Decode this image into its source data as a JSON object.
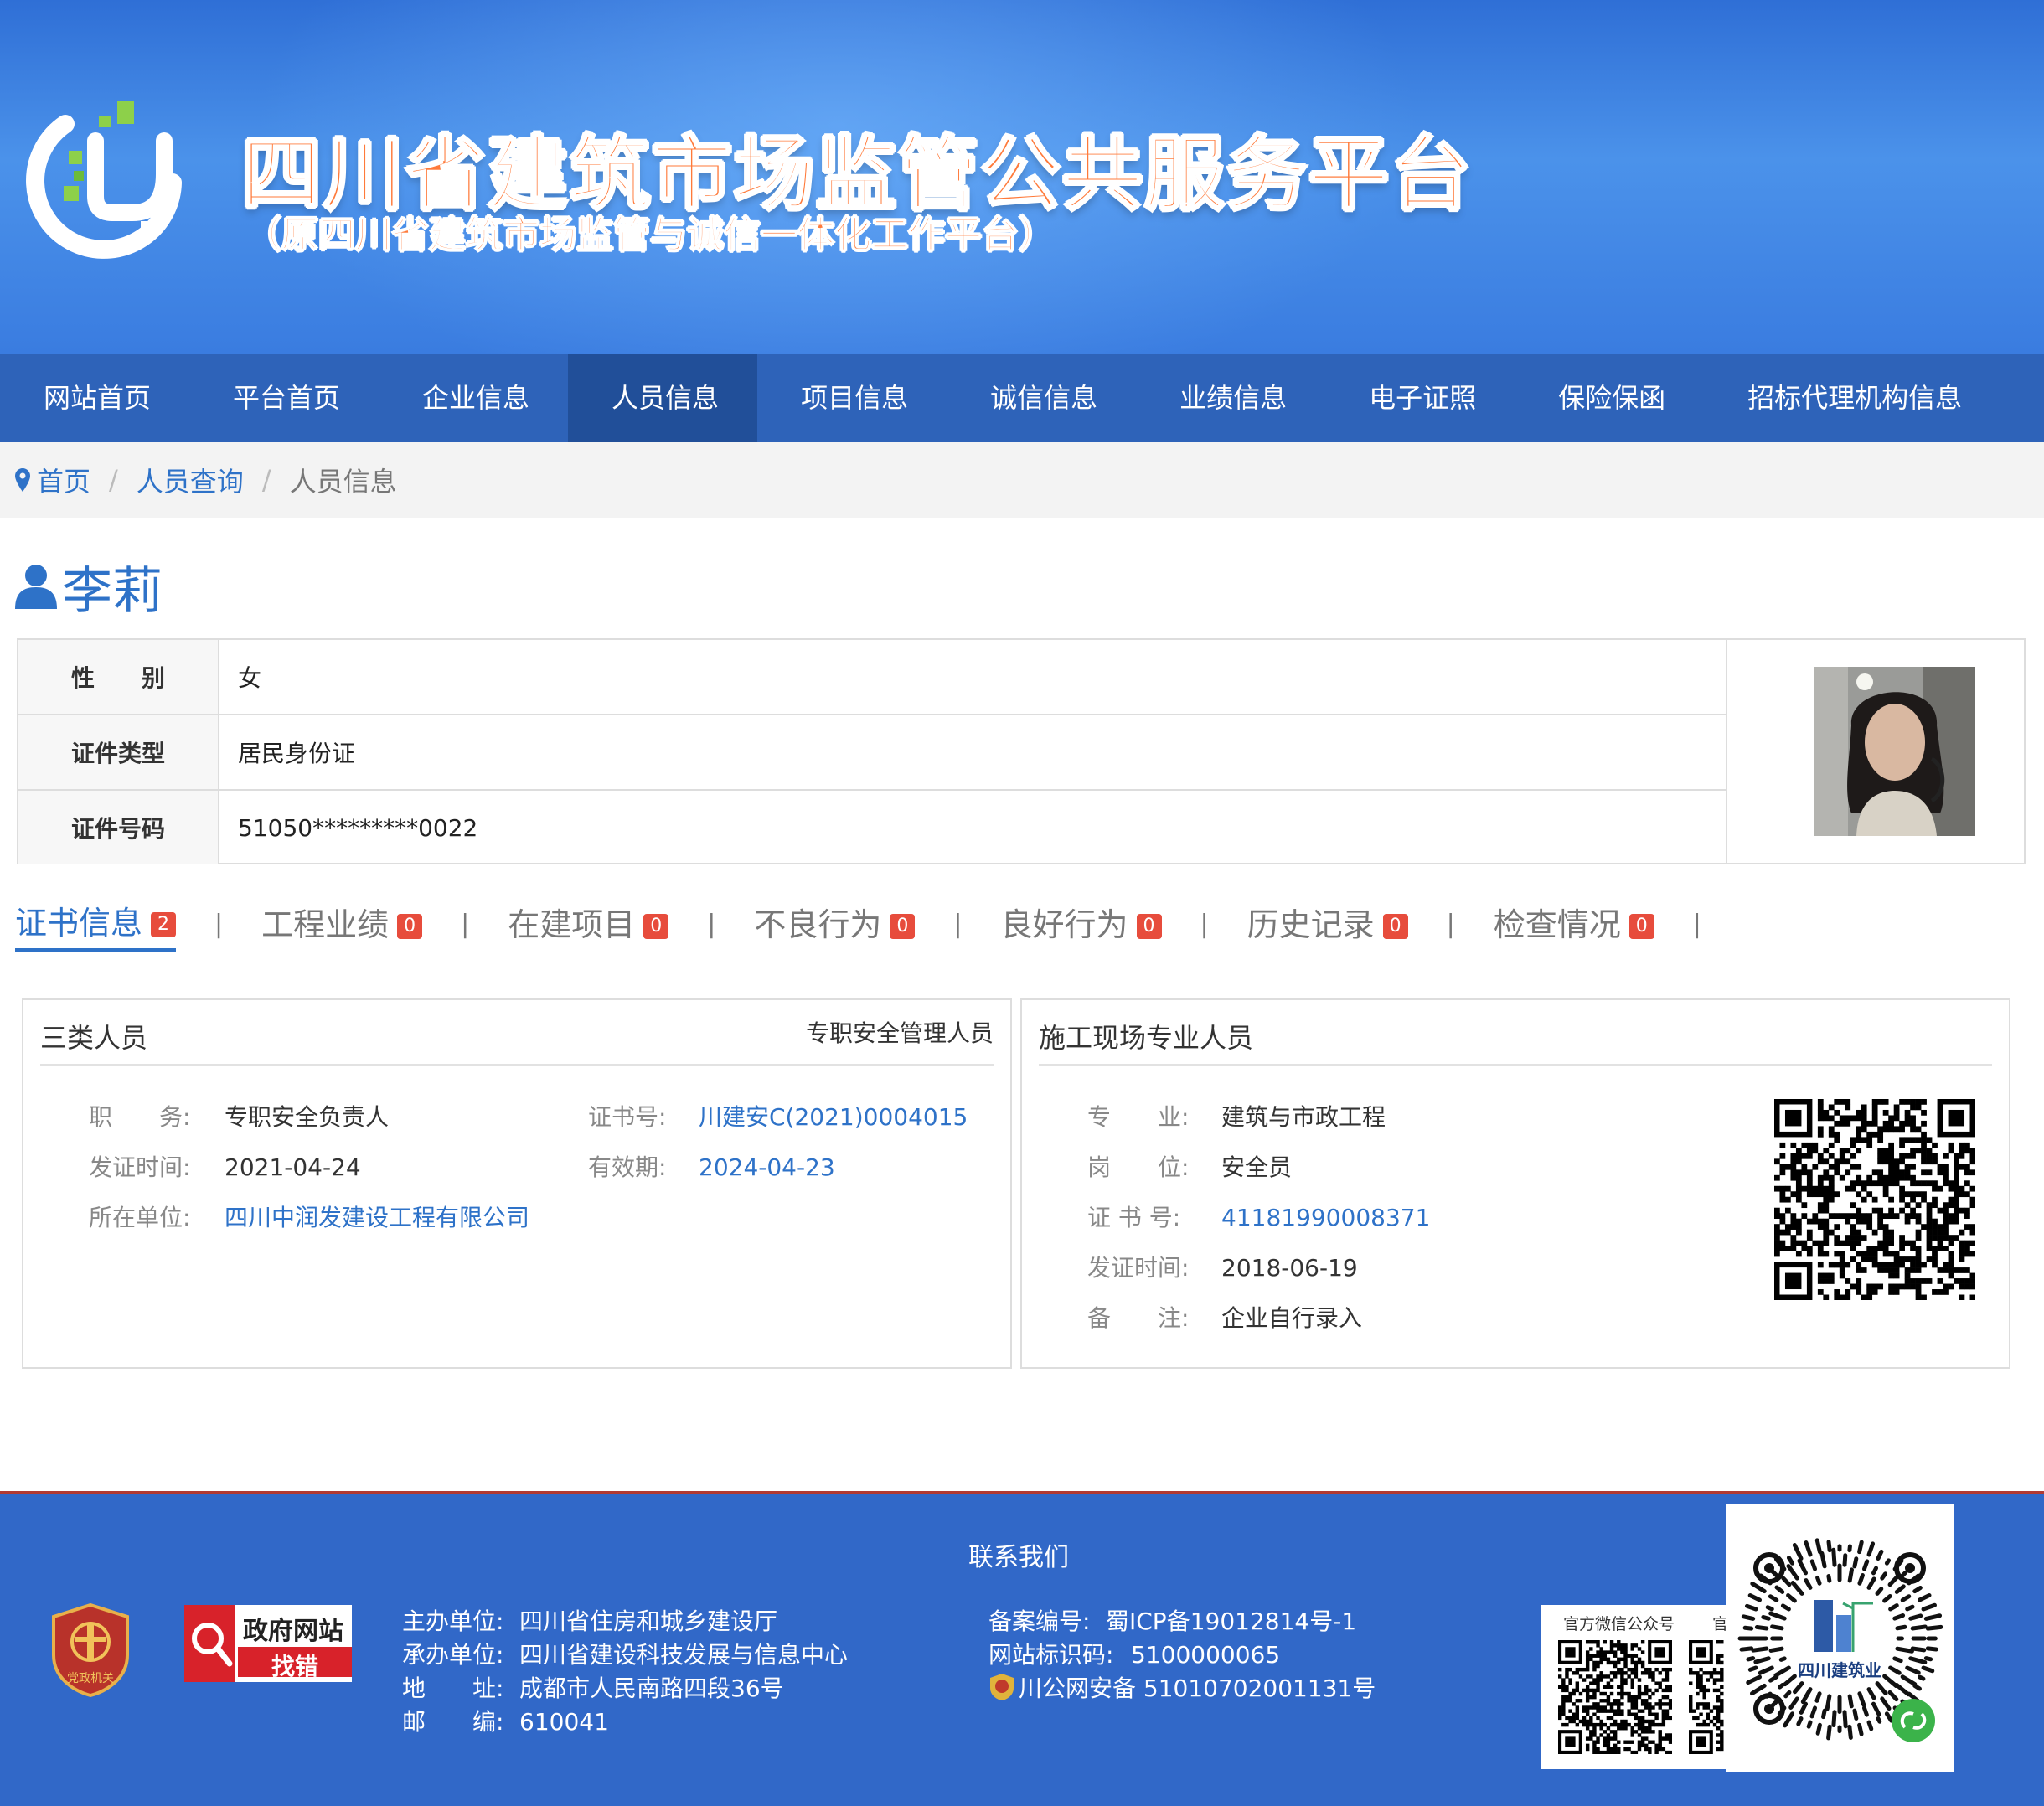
{
  "header": {
    "title": "四川省建筑市场监管公共服务平台",
    "subtitle": "（原四川省建筑市场监管与诚信一体化工作平台）"
  },
  "nav": {
    "items": [
      {
        "label": "网站首页"
      },
      {
        "label": "平台首页"
      },
      {
        "label": "企业信息"
      },
      {
        "label": "人员信息",
        "active": true
      },
      {
        "label": "项目信息"
      },
      {
        "label": "诚信信息"
      },
      {
        "label": "业绩信息"
      },
      {
        "label": "电子证照"
      },
      {
        "label": "保险保函"
      },
      {
        "label": "招标代理机构信息"
      }
    ]
  },
  "breadcrumb": {
    "items": [
      "首页",
      "人员查询",
      "人员信息"
    ],
    "separator": "/"
  },
  "person": {
    "name": "李莉",
    "rows": [
      {
        "label": "性　　别",
        "value": "女"
      },
      {
        "label": "证件类型",
        "value": "居民身份证"
      },
      {
        "label": "证件号码",
        "value": "51050*********0022"
      }
    ]
  },
  "tabs": [
    {
      "label": "证书信息",
      "count": "2",
      "active": true
    },
    {
      "label": "工程业绩",
      "count": "0"
    },
    {
      "label": "在建项目",
      "count": "0"
    },
    {
      "label": "不良行为",
      "count": "0"
    },
    {
      "label": "良好行为",
      "count": "0"
    },
    {
      "label": "历史记录",
      "count": "0"
    },
    {
      "label": "检查情况",
      "count": "0"
    }
  ],
  "tab_separator": "|",
  "cert_left": {
    "title": "三类人员",
    "tag": "专职安全管理人员",
    "fields": {
      "duty_label": "职　　务:",
      "duty": "专职安全负责人",
      "certno_label": "证书号:",
      "certno": "川建安C(2021)0004015",
      "issue_label": "发证时间:",
      "issue": "2021-04-24",
      "valid_label": "有效期:",
      "valid": "2024-04-23",
      "unit_label": "所在单位:",
      "unit": "四川中润发建设工程有限公司"
    }
  },
  "cert_right": {
    "title": "施工现场专业人员",
    "fields": {
      "major_label": "专　　业:",
      "major": "建筑与市政工程",
      "post_label": "岗　　位:",
      "post": "安全员",
      "certno_label": "证 书 号:",
      "certno": "41181990008371",
      "issue_label": "发证时间:",
      "issue": "2018-06-19",
      "note_label": "备　　注:",
      "note": "企业自行录入"
    }
  },
  "footer": {
    "contact": "联系我们",
    "emblem_text": "党政机关",
    "findbug": {
      "line1": "政府网站",
      "line2": "找错"
    },
    "sponsor_label": "主办单位:",
    "sponsor": "四川省住房和城乡建设厅",
    "undertaker_label": "承办单位:",
    "undertaker": "四川省建设科技发展与信息中心",
    "address_label": "地　　址:",
    "address": "成都市人民南路四段36号",
    "postcode_label": "邮　　编:",
    "postcode": "610041",
    "icp_label": "备案编号:",
    "icp": "蜀ICP备19012814号-1",
    "siteid_label": "网站标识码:",
    "siteid": "5100000065",
    "police": "川公网安备 51010702001131号",
    "wechat_caption": "官方微信公众号",
    "wechat_caption2": "官",
    "miniapp_label": "四川建筑业"
  },
  "colors": {
    "brand_blue": "#2e63b9",
    "nav_active": "#214f99",
    "link": "#2e72c8",
    "badge": "#e74c3c",
    "title_orange": "#ff7a3a",
    "footer_bg": "#3168c8"
  }
}
